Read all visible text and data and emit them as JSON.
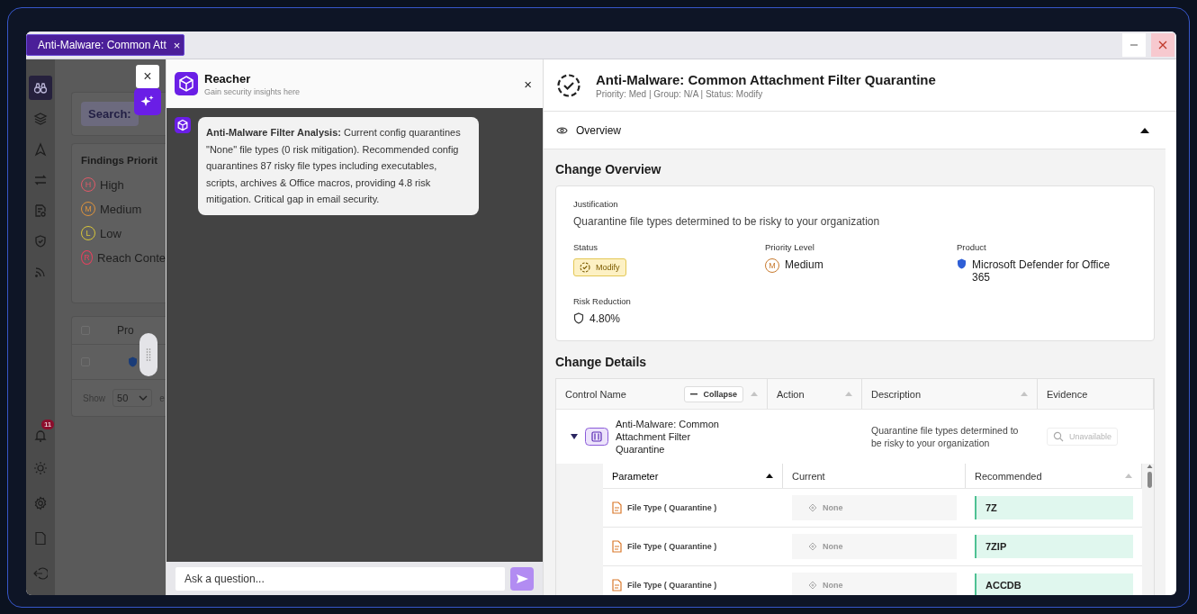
{
  "tab": {
    "title": "Anti-Malware: Common Att",
    "close": "×"
  },
  "sidebar": {
    "items": [
      {
        "selected": true
      },
      {
        "selected": false
      },
      {
        "selected": false
      },
      {
        "selected": false
      },
      {
        "selected": false
      },
      {
        "selected": false
      },
      {
        "selected": false
      }
    ],
    "notifications": "11"
  },
  "background_page": {
    "search": "Search:",
    "priority_title": "Findings Priorit",
    "priorities": [
      {
        "letter": "H",
        "label": "High",
        "color": "#e05a68"
      },
      {
        "letter": "M",
        "label": "Medium",
        "color": "#e0943c"
      },
      {
        "letter": "L",
        "label": "Low",
        "color": "#d8c63a"
      },
      {
        "letter": "R",
        "label": "Reach Conte",
        "color": "#e8405e"
      }
    ],
    "table_header": "Pro",
    "header_checked": false,
    "row_checked": false,
    "pager_label": "Show",
    "pager_value": "50",
    "pager_after": "e"
  },
  "float_close": "×",
  "reacher": {
    "title": "Reacher",
    "subtitle": "Gain security insights here",
    "close": "×",
    "message": "**Anti-Malware Filter Analysis:** Current config quarantines \"None\" file types (0 risk mitigation). Recommended config quarantines 87 risky file types including executables, scripts, archives & Office macros, providing 4.8 risk mitigation. Critical gap in email security.",
    "input_placeholder": "Ask a question..."
  },
  "details": {
    "title": "Anti-Malware: Common Attachment Filter Quarantine",
    "subtitle": "Priority: Med | Group: N/A | Status: Modify",
    "overview": {
      "label": "Overview",
      "expanded": true
    },
    "change_overview": {
      "heading": "Change Overview",
      "justification_label": "Justification",
      "justification": "Quarantine file types determined to be risky to your organization",
      "status_label": "Status",
      "status": "Modify",
      "priority_label": "Priority Level",
      "priority_letter": "M",
      "priority": "Medium",
      "product_label": "Product",
      "product": "Microsoft Defender for Office 365",
      "risk_label": "Risk Reduction",
      "risk": "4.80%"
    },
    "change_details": {
      "heading": "Change Details",
      "collapse": "Collapse",
      "columns": [
        {
          "label": "Control Name",
          "sortable": true,
          "sorted": false
        },
        {
          "label": "Action",
          "sortable": true,
          "sorted": false
        },
        {
          "label": "Description",
          "sortable": true,
          "sorted": false
        },
        {
          "label": "Evidence",
          "sortable": false
        }
      ],
      "row": {
        "expanded": true,
        "name": "Anti-Malware: Common Attachment Filter Quarantine",
        "description": "Quarantine file types determined to be risky to your organization",
        "evidence": "Unavailable",
        "evidence_disabled": true
      },
      "param_columns": [
        {
          "label": "Parameter",
          "sortable": true,
          "sorted": true
        },
        {
          "label": "Current",
          "sortable": false
        },
        {
          "label": "Recommended",
          "sortable": true,
          "sorted": false
        }
      ],
      "params": [
        {
          "parameter": "File Type ( Quarantine )",
          "current": "None",
          "recommended": "7Z"
        },
        {
          "parameter": "File Type ( Quarantine )",
          "current": "None",
          "recommended": "7ZIP"
        },
        {
          "parameter": "File Type ( Quarantine )",
          "current": "None",
          "recommended": "ACCDB"
        }
      ]
    }
  }
}
